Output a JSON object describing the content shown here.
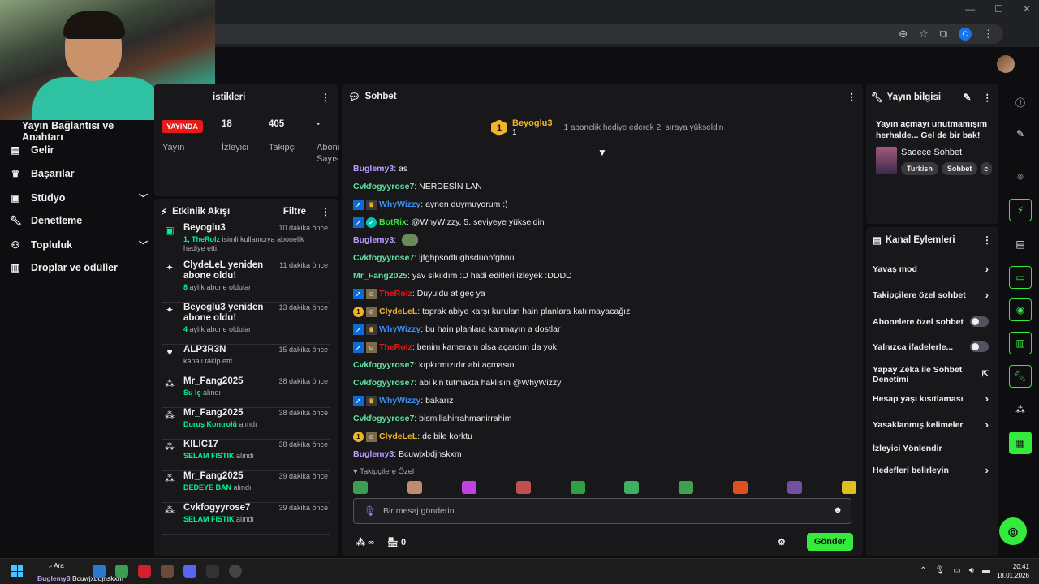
{
  "browser": {
    "window_controls": [
      "—",
      "☐",
      "✕"
    ],
    "profile_initial": "C"
  },
  "left_nav": {
    "title": "Yayın Bağlantısı ve Anahtarı",
    "items": [
      {
        "label": "Gelir",
        "icon": "money-icon"
      },
      {
        "label": "Başarılar",
        "icon": "trophy-icon"
      },
      {
        "label": "Stüdyo",
        "icon": "studio-icon",
        "expandable": true
      },
      {
        "label": "Denetleme",
        "icon": "wrench-icon"
      },
      {
        "label": "Topluluk",
        "icon": "community-icon",
        "expandable": true
      },
      {
        "label": "Droplar ve ödüller",
        "icon": "drops-icon"
      }
    ]
  },
  "stats": {
    "title": "istikleri",
    "live_badge": "YAYINDA",
    "labels": [
      "Yayın",
      "İzleyici",
      "Takipçi",
      "Abone Sayısı"
    ],
    "values": [
      "18",
      "405",
      "-"
    ]
  },
  "activity": {
    "title": "Etkinlik Akışı",
    "filter_label": "Filtre",
    "items": [
      {
        "name": "Beyoglu3",
        "time": "10 dakika önce",
        "highlight": "1, TheRolz",
        "desc": " isimli kullanıcıya abonelik hediye etti.",
        "icon": "gift-icon"
      },
      {
        "name": "ClydeLeL yeniden abone oldu!",
        "time": "11 dakika önce",
        "highlight": "8",
        "desc": " aylık abone oldular",
        "icon": "star-icon"
      },
      {
        "name": "Beyoglu3 yeniden abone oldu!",
        "time": "13 dakika önce",
        "highlight": "4",
        "desc": " aylık abone oldular",
        "icon": "star-icon"
      },
      {
        "name": "ALP3R3N",
        "time": "15 dakika önce",
        "highlight": "",
        "desc": "kanalı takip etti",
        "icon": "heart-icon"
      },
      {
        "name": "Mr_Fang2025",
        "time": "38 dakika önce",
        "highlight": "Su İç",
        "desc": " alındı",
        "icon": "points-icon"
      },
      {
        "name": "Mr_Fang2025",
        "time": "38 dakika önce",
        "highlight": "Duruş Kontrolü",
        "desc": " alındı",
        "icon": "points-icon"
      },
      {
        "name": "KILIC17",
        "time": "38 dakika önce",
        "highlight": "SELAM FISTIK",
        "desc": " alındı",
        "icon": "points-icon"
      },
      {
        "name": "Mr_Fang2025",
        "time": "39 dakika önce",
        "highlight": "DEDEYE BAN",
        "desc": " alındı",
        "icon": "points-icon"
      },
      {
        "name": "Cvkfogyyrose7",
        "time": "39 dakika önce",
        "highlight": "SELAM FISTIK",
        "desc": " alındı",
        "icon": "points-icon"
      }
    ]
  },
  "chat": {
    "title": "Sohbet",
    "pinned": {
      "badge": "1",
      "user": "Beyoglu3",
      "count": "1",
      "message": "1 abonelik hediye ederek 2. sıraya yükseldin"
    },
    "messages": [
      {
        "user": "Buglemy3",
        "color": "#b99cff",
        "badges": [],
        "text": "as"
      },
      {
        "user": "Cvkfogyyrose7",
        "color": "#5ee0a0",
        "badges": [],
        "text": "NERDESİN LAN"
      },
      {
        "user": "WhyWizzy",
        "color": "#3a8df0",
        "badges": [
          "mod",
          "crown"
        ],
        "text": "aynen duymuyorum :)"
      },
      {
        "user": "BotRix",
        "color": "#34eb3d",
        "badges": [
          "mod",
          "vip"
        ],
        "text": "@WhyWizzy, 5. seviyeye yükseldin"
      },
      {
        "user": "Buglemy3",
        "color": "#b99cff",
        "badges": [],
        "text": "",
        "emote": true
      },
      {
        "user": "Cvkfogyyrose7",
        "color": "#5ee0a0",
        "badges": [],
        "text": "ljfghpsodfughsduopfghnü"
      },
      {
        "user": "Mr_Fang2025",
        "color": "#5ee0a0",
        "badges": [],
        "text": "yav sıkıldım :D hadi editleri izleyek :DDDD"
      },
      {
        "user": "TheRolz",
        "color": "#e91916",
        "badges": [
          "mod",
          "face"
        ],
        "text": "Duyuldu at geç ya"
      },
      {
        "user": "ClydeLeL",
        "color": "#f0b429",
        "badges": [
          "sub",
          "face"
        ],
        "text": "toprak abiye karşı kurulan hain planlara katılmayacağız"
      },
      {
        "user": "WhyWizzy",
        "color": "#3a8df0",
        "badges": [
          "mod",
          "crown"
        ],
        "text": "bu hain planlara kanmayın a dostlar"
      },
      {
        "user": "TheRolz",
        "color": "#e91916",
        "badges": [
          "mod",
          "face"
        ],
        "text": "benim kameram olsa açardım da yok"
      },
      {
        "user": "Cvkfogyyrose7",
        "color": "#5ee0a0",
        "badges": [],
        "text": "kıpkırmızıdır abi açmasın"
      },
      {
        "user": "Cvkfogyyrose7",
        "color": "#5ee0a0",
        "badges": [],
        "text": "abi kin tutmakta haklısın @WhyWizzy"
      },
      {
        "user": "WhyWizzy",
        "color": "#3a8df0",
        "badges": [
          "mod",
          "crown"
        ],
        "text": "bakarız"
      },
      {
        "user": "Cvkfogyyrose7",
        "color": "#5ee0a0",
        "badges": [],
        "text": "bismillahirrahmanirrahim"
      },
      {
        "user": "ClydeLeL",
        "color": "#f0b429",
        "badges": [
          "sub",
          "face"
        ],
        "text": "dc bile korktu"
      },
      {
        "user": "Buglemy3",
        "color": "#b99cff",
        "badges": [],
        "text": "Bcuwjxbdjnskxm"
      }
    ],
    "follower_label": "Takipçilere Özel",
    "emote_colors": [
      "#3aa050",
      "#c08a70",
      "#c040e0",
      "#c05050",
      "#30a040",
      "#40b060",
      "#40a050",
      "#e05020",
      "#7050a0",
      "#e0c020"
    ],
    "input_placeholder": "Bir mesaj gönderin",
    "points": "∞",
    "store_count": "0",
    "send_label": "Gönder"
  },
  "stream_info": {
    "title": "Yayın bilgisi",
    "text": "Yayın açmayı unutmamışım herhalde... Gel de bir bak!",
    "category": "Sadece Sohbet",
    "tags": [
      "Turkish",
      "Sohbet",
      "c"
    ]
  },
  "channel_actions": {
    "title": "Kanal Eylemleri",
    "rows": [
      {
        "label": "Yavaş mod",
        "control": "chevron"
      },
      {
        "label": "Takipçilere özel sohbet",
        "control": "chevron"
      },
      {
        "label": "Abonelere özel sohbet",
        "control": "toggle"
      },
      {
        "label": "Yalnızca ifadelerle...",
        "control": "toggle"
      },
      {
        "label": "Yapay Zeka ile Sohbet Denetimi",
        "control": "external"
      },
      {
        "label": "Hesap yaşı kısıtlaması",
        "control": "chevron"
      },
      {
        "label": "Yasaklanmış kelimeler",
        "control": "chevron"
      },
      {
        "label": "İzleyici Yönlendir",
        "control": "none"
      },
      {
        "label": "Hedefleri belirleyin",
        "control": "chevron"
      }
    ]
  },
  "taskbar": {
    "search_label": "Ara",
    "ticker_user": "Buglemy3",
    "ticker_text": "Bcuwjxbdjnskxm",
    "time": "20:41",
    "date": "18.01.2026"
  }
}
